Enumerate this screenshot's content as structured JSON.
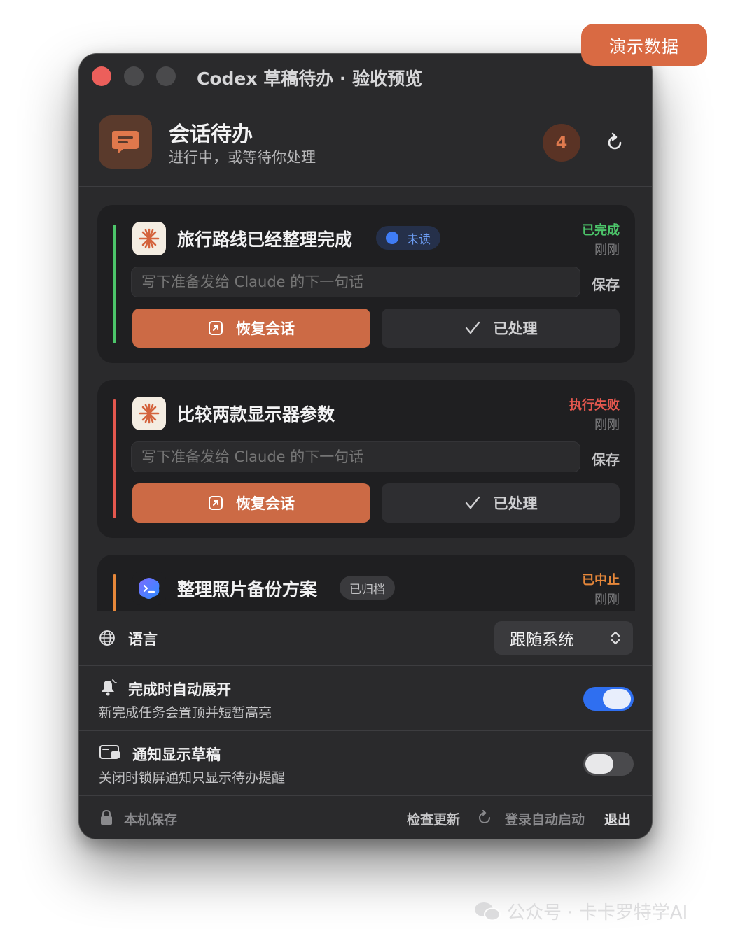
{
  "demo_badge": "演示数据",
  "window": {
    "title": "Codex 草稿待办 · 验收预览"
  },
  "header": {
    "title": "会话待办",
    "subtitle": "进行中，或等待你处理",
    "count": "4"
  },
  "cards": [
    {
      "title": "旅行路线已经整理完成",
      "tag": "未读",
      "status": "已完成",
      "status_color": "#4cc56a",
      "time": "刚刚",
      "draft_placeholder": "写下准备发给 Claude 的下一句话",
      "save": "保存",
      "resume": "恢复会话",
      "done": "已处理"
    },
    {
      "title": "比较两款显示器参数",
      "status": "执行失败",
      "status_color": "#e4574e",
      "time": "刚刚",
      "draft_placeholder": "写下准备发给 Claude 的下一句话",
      "save": "保存",
      "resume": "恢复会话",
      "done": "已处理"
    },
    {
      "title": "整理照片备份方案",
      "tag": "已归档",
      "status": "已中止",
      "status_color": "#e6873a",
      "time": "刚刚"
    }
  ],
  "settings": {
    "language": {
      "label": "语言",
      "value": "跟随系统"
    },
    "auto_expand": {
      "label": "完成时自动展开",
      "sub": "新完成任务会置顶并短暂高亮",
      "on": true
    },
    "show_draft": {
      "label": "通知显示草稿",
      "sub": "关闭时锁屏通知只显示待办提醒",
      "on": false
    }
  },
  "footer": {
    "local": "本机保存",
    "check": "检查更新",
    "autostart": "登录自动启动",
    "quit": "退出"
  },
  "watermark": "公众号 · 卡卡罗特学AI"
}
